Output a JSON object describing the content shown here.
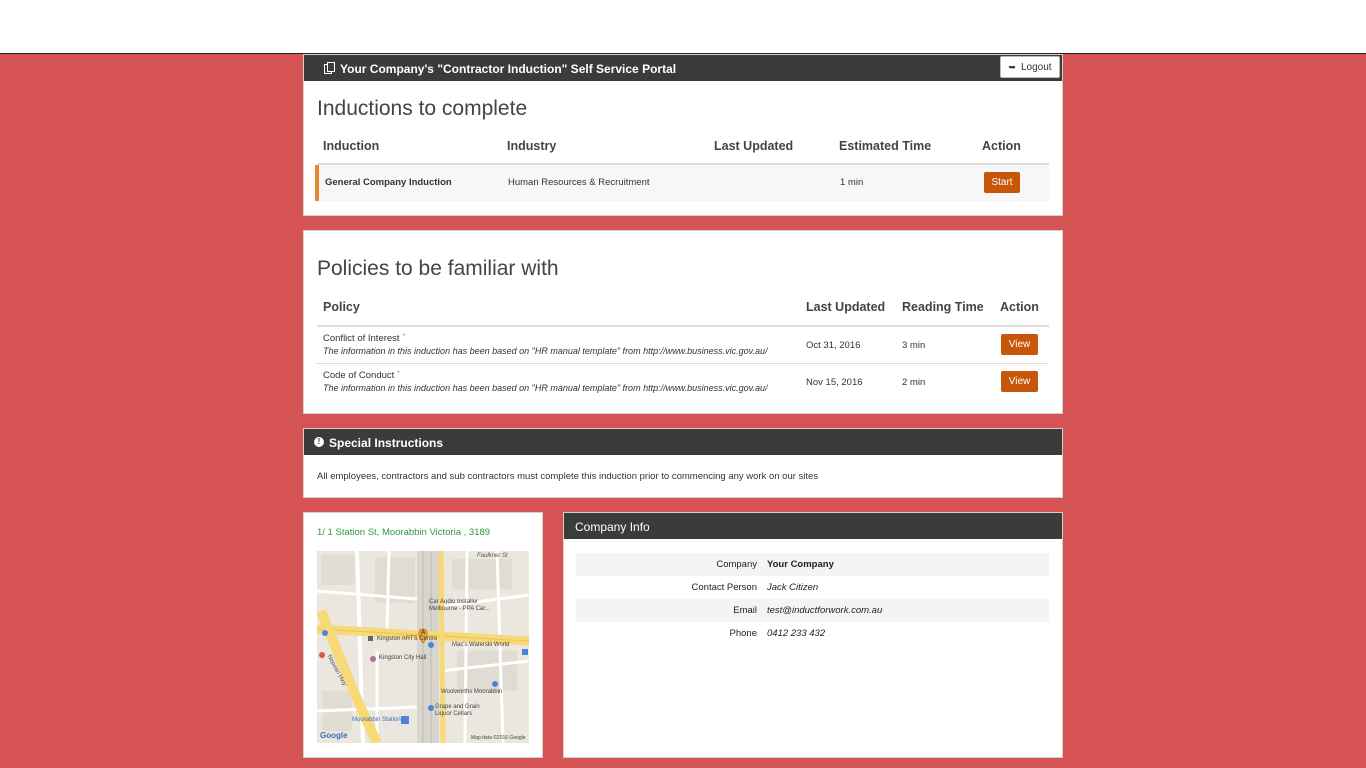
{
  "header": {
    "title": "Your Company's \"Contractor Induction\" Self Service Portal",
    "logout_label": "Logout"
  },
  "inductions": {
    "title": "Inductions to complete",
    "columns": [
      "Induction",
      "Industry",
      "Last Updated",
      "Estimated Time",
      "Action"
    ],
    "rows": [
      {
        "name": "General Company Induction",
        "industry": "Human Resources & Recruitment",
        "last_updated": "",
        "estimated_time": "1 min",
        "action": "Start"
      }
    ]
  },
  "policies": {
    "title": "Policies to be familiar with",
    "columns": [
      "Policy",
      "Last Updated",
      "Reading Time",
      "Action"
    ],
    "rows": [
      {
        "name": "Conflict of Interest `",
        "note": "The information in this induction has been based on \"HR manual template\" from http://www.business.vic.gov.au/",
        "last_updated": "Oct 31, 2016",
        "reading_time": "3 min",
        "action": "View"
      },
      {
        "name": "Code of Conduct `",
        "note": "The information in this induction has been based on \"HR manual template\" from http://www.business.vic.gov.au/",
        "last_updated": "Nov 15, 2016",
        "reading_time": "2 min",
        "action": "View"
      }
    ]
  },
  "special": {
    "title": "Special Instructions",
    "text": "All employees, contractors and sub contractors must complete this induction prior to commencing any work on our sites"
  },
  "location": {
    "address": "1/ 1 Station St, Moorabbin Victoria , 3189",
    "map_labels": {
      "car_audio": "Car Audio Installer",
      "car_audio2": "Melbourne - PPA Car...",
      "kingston_arts": "Kingston ARTS Centre",
      "macs": "Mac's Waterski World",
      "kingston_hall": "Kingston City Hall",
      "woolworths": "Woolworths Moorabbin",
      "grape": "Grape and Grain",
      "grape2": "Liquor Cellars",
      "station": "Moorabbin Station",
      "nepean": "Nepean Hwy",
      "faulkner": "Faulkner St",
      "google": "Google",
      "mapdata": "Map data ©2016 Google",
      "marker": "A"
    }
  },
  "company_info": {
    "title": "Company Info",
    "rows": [
      {
        "label": "Company",
        "value": "Your Company",
        "style": "bold"
      },
      {
        "label": "Contact Person",
        "value": "Jack Citizen",
        "style": "italic"
      },
      {
        "label": "Email",
        "value": "test@inductforwork.com.au",
        "style": "italic"
      },
      {
        "label": "Phone",
        "value": "0412 233 432",
        "style": "italic"
      }
    ]
  },
  "colors": {
    "background": "#d55352",
    "accent": "#c8560a",
    "header_dark": "#3a3c3c",
    "address_green": "#2e9a3e"
  }
}
